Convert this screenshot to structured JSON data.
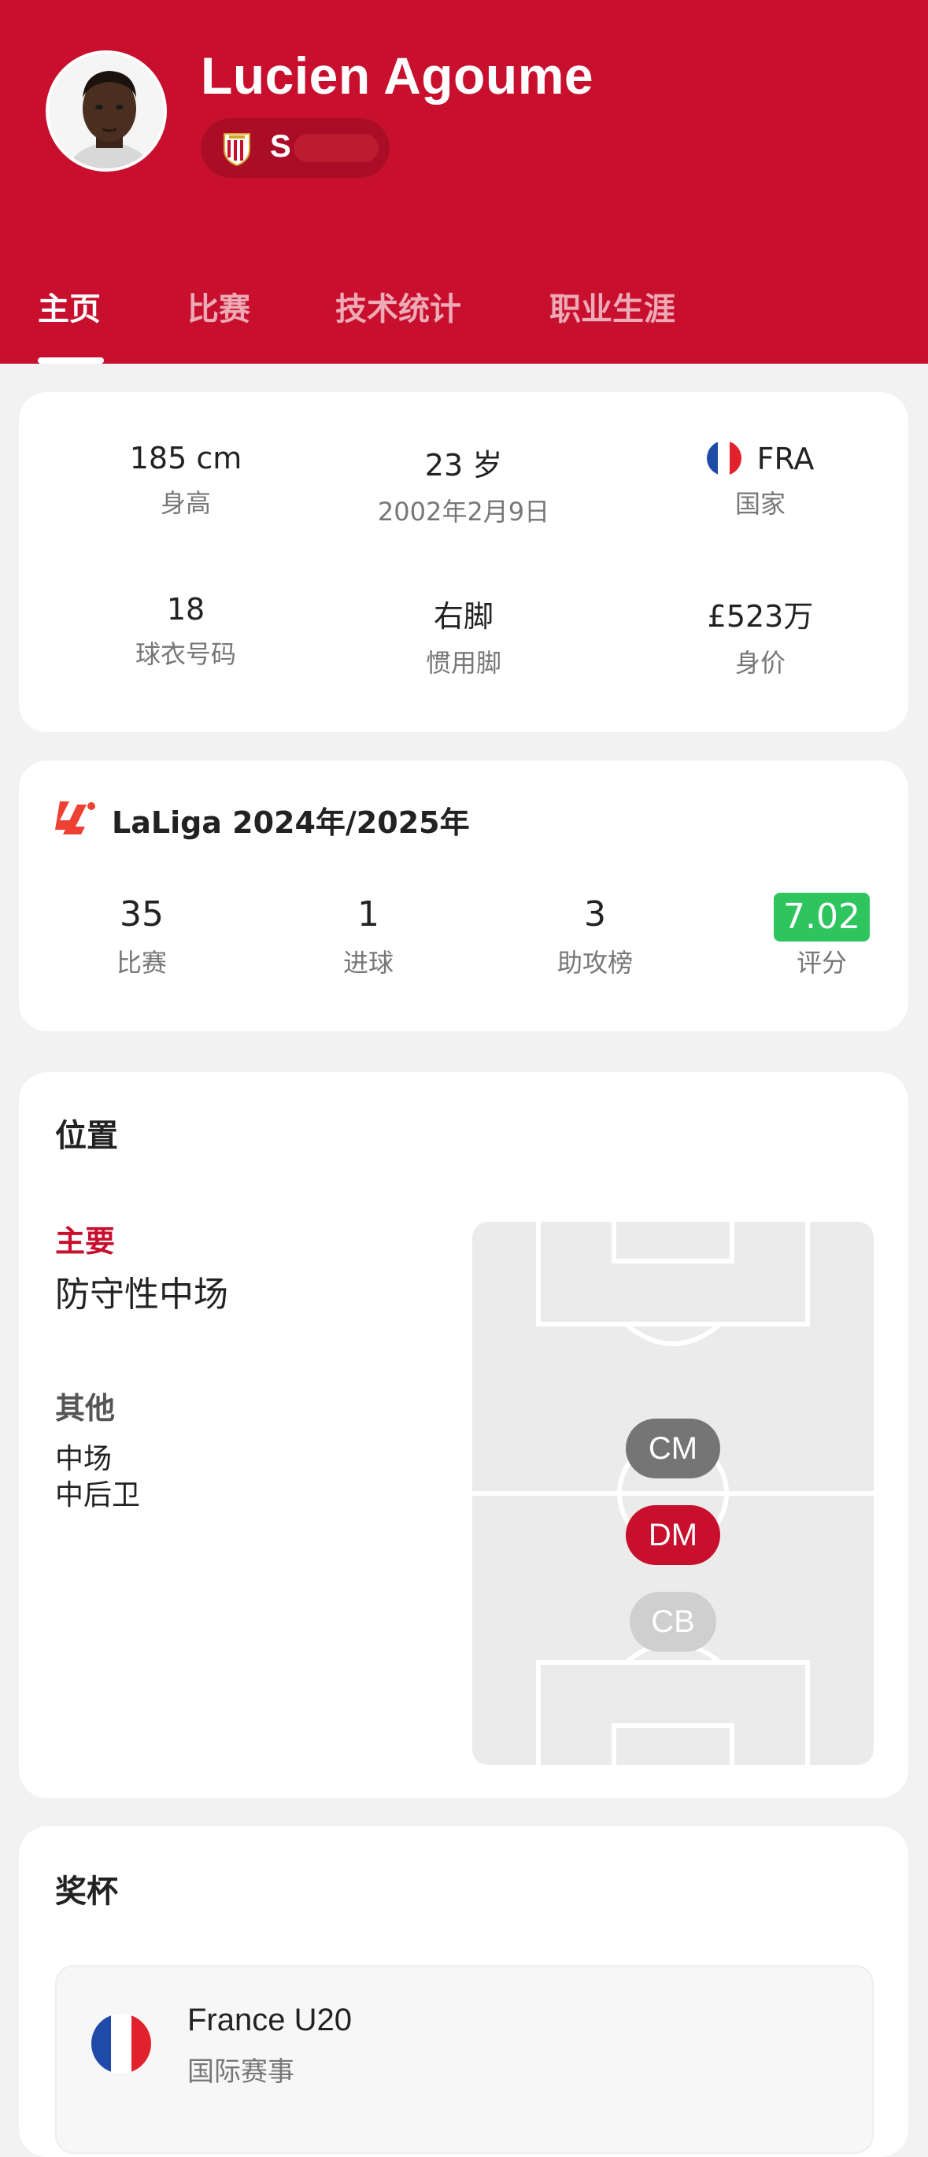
{
  "header": {
    "player_name": "Lucien Agoume",
    "club_name": "S",
    "colors": {
      "brand": "#c8102e",
      "rating": "#2ec55f"
    }
  },
  "tabs": [
    {
      "label": "主页",
      "active": true
    },
    {
      "label": "比赛",
      "active": false
    },
    {
      "label": "技术统计",
      "active": false
    },
    {
      "label": "职业生涯",
      "active": false
    }
  ],
  "info": {
    "height": {
      "value": "185 cm",
      "label": "身高"
    },
    "age": {
      "value": "23 岁",
      "label": "2002年2月9日"
    },
    "country": {
      "value": "FRA",
      "label": "国家",
      "flag_icon": "france-flag-icon"
    },
    "shirt": {
      "value": "18",
      "label": "球衣号码"
    },
    "foot": {
      "value": "右脚",
      "label": "惯用脚"
    },
    "market_value": {
      "value": "£523万",
      "label": "身价"
    }
  },
  "league": {
    "title": "LaLiga 2024年/2025年",
    "logo_icon": "laliga-logo-icon",
    "stats": [
      {
        "value": "35",
        "label": "比赛"
      },
      {
        "value": "1",
        "label": "进球"
      },
      {
        "value": "3",
        "label": "助攻榜"
      },
      {
        "value": "7.02",
        "label": "评分"
      }
    ]
  },
  "position": {
    "title": "位置",
    "primary_label": "主要",
    "primary_value": "防守性中场",
    "other_label": "其他",
    "others": [
      "中场",
      "中后卫"
    ],
    "badges": [
      "CM",
      "DM",
      "CB"
    ]
  },
  "trophies": {
    "title": "奖杯",
    "items": [
      {
        "name": "France U20",
        "type": "国际赛事",
        "flag_icon": "france-flag-icon"
      }
    ]
  }
}
